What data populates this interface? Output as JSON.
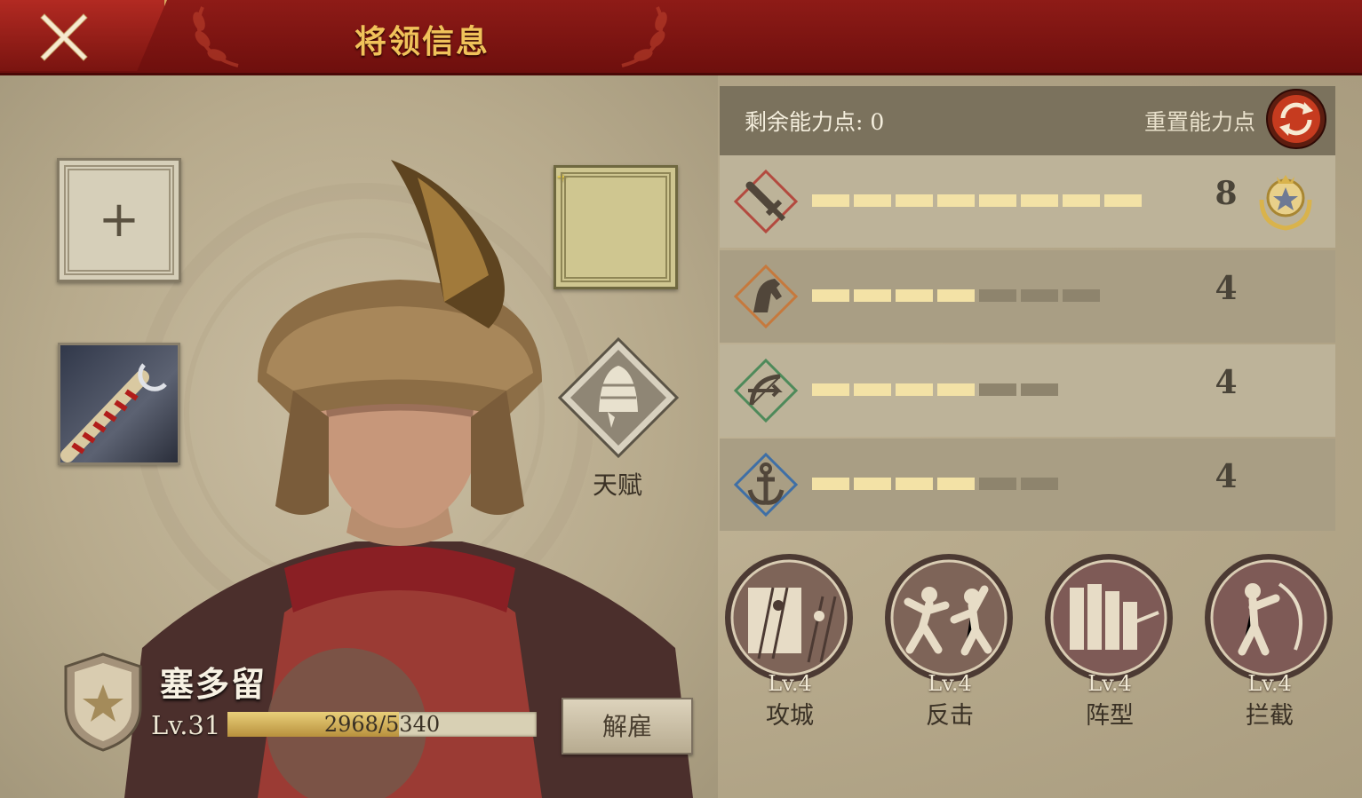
{
  "header": {
    "title": "将领信息"
  },
  "hero": {
    "name": "塞多留",
    "level": "Lv.31",
    "xp_text": "2968/5340",
    "xp_fraction": 0.5558,
    "dismiss_label": "解雇"
  },
  "talent": {
    "label": "天赋"
  },
  "stats": {
    "remaining_label": "剩余能力点: 0",
    "reset_label": "重置能力点",
    "rows": [
      {
        "icon": "sword-icon",
        "value": "8",
        "filled": 8,
        "total": 8
      },
      {
        "icon": "horse-icon",
        "value": "4",
        "filled": 4,
        "total": 7
      },
      {
        "icon": "bow-icon",
        "value": "4",
        "filled": 4,
        "total": 6
      },
      {
        "icon": "anchor-icon",
        "value": "4",
        "filled": 4,
        "total": 6
      }
    ]
  },
  "skills": [
    {
      "level": "Lv.4",
      "name": "攻城"
    },
    {
      "level": "Lv.4",
      "name": "反击"
    },
    {
      "level": "Lv.4",
      "name": "阵型"
    },
    {
      "level": "Lv.4",
      "name": "拦截"
    }
  ],
  "colors": {
    "header": "#7e1512",
    "accent_gold": "#f0c25a",
    "pip_on": "#f3e2a6",
    "pip_off": "#8e846d"
  }
}
